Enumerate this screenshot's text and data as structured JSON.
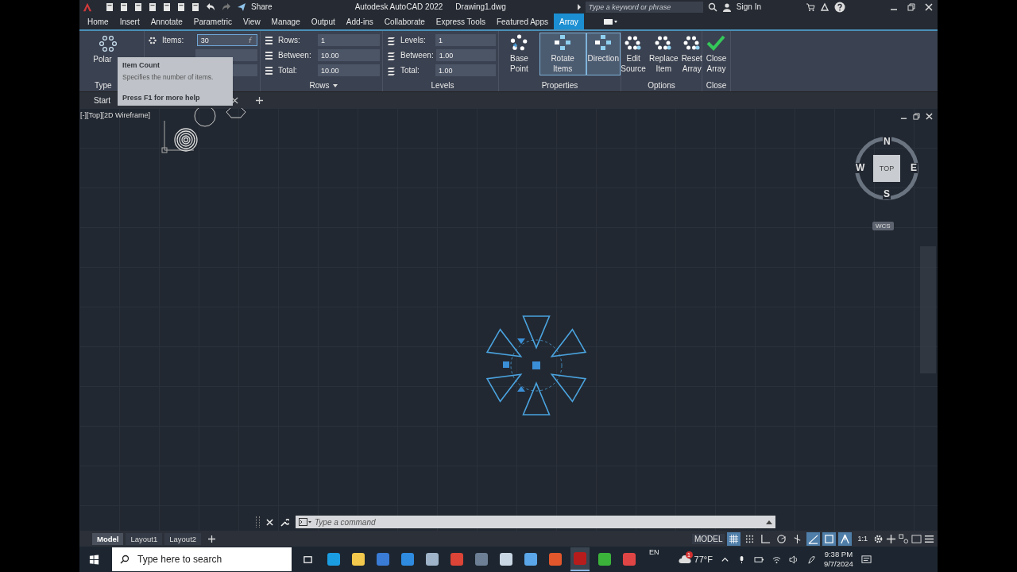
{
  "title_bar": {
    "share": "Share",
    "app_title": "Autodesk AutoCAD 2022",
    "file_name": "Drawing1.dwg",
    "search": {
      "placeholder": "Type a keyword or phrase"
    },
    "sign_in": "Sign In"
  },
  "ribbon_tabs": [
    {
      "label": "Home",
      "selected": false
    },
    {
      "label": "Insert",
      "selected": false
    },
    {
      "label": "Annotate",
      "selected": false
    },
    {
      "label": "Parametric",
      "selected": false
    },
    {
      "label": "View",
      "selected": false
    },
    {
      "label": "Manage",
      "selected": false
    },
    {
      "label": "Output",
      "selected": false
    },
    {
      "label": "Add-ins",
      "selected": false
    },
    {
      "label": "Collaborate",
      "selected": false
    },
    {
      "label": "Express Tools",
      "selected": false
    },
    {
      "label": "Featured Apps",
      "selected": false
    },
    {
      "label": "Array",
      "selected": true
    }
  ],
  "ribbon": {
    "type_panel": {
      "button": "Polar",
      "title": "Type"
    },
    "items_panel": {
      "label": "Items:",
      "value": "30"
    },
    "rows_panel": {
      "title": "Rows",
      "fields": [
        {
          "label": "Rows:",
          "value": "1"
        },
        {
          "label": "Between:",
          "value": "10.00"
        },
        {
          "label": "Total:",
          "value": "10.00"
        }
      ]
    },
    "levels_panel": {
      "title": "Levels",
      "fields": [
        {
          "label": "Levels:",
          "value": "1"
        },
        {
          "label": "Between:",
          "value": "1.00"
        },
        {
          "label": "Total:",
          "value": "1.00"
        }
      ]
    },
    "properties_panel": {
      "title": "Properties",
      "buttons": [
        {
          "label": "Base Point",
          "selected": false
        },
        {
          "label": "Rotate Items",
          "selected": true
        },
        {
          "label": "Direction",
          "selected": true
        }
      ]
    },
    "options_panel": {
      "title": "Options",
      "buttons": [
        {
          "line1": "Edit",
          "line2": "Source"
        },
        {
          "line1": "Replace",
          "line2": "Item"
        },
        {
          "line1": "Reset",
          "line2": "Array"
        }
      ]
    },
    "close_panel": {
      "title": "Close",
      "line1": "Close",
      "line2": "Array"
    }
  },
  "tooltip": {
    "title": "Item Count",
    "description": "Specifies the number of items.",
    "help": "Press F1 for more help"
  },
  "file_tabs": [
    {
      "label": "Start"
    }
  ],
  "viewport": {
    "label": "[-][Top][2D Wireframe]",
    "viewcube": {
      "north": "N",
      "west": "W",
      "east": "E",
      "south": "S",
      "face": "TOP",
      "ucs": "WCS"
    }
  },
  "command_line": {
    "placeholder": "Type a command"
  },
  "layout_tabs": [
    {
      "label": "Model",
      "selected": true
    },
    {
      "label": "Layout1",
      "selected": false
    },
    {
      "label": "Layout2",
      "selected": false
    }
  ],
  "status_bar": {
    "space": "MODEL",
    "scale": "1:1",
    "toggles": [
      {
        "kind": "grid",
        "on": true
      },
      {
        "kind": "snap",
        "on": false
      },
      {
        "kind": "ortho",
        "on": false
      },
      {
        "kind": "polar",
        "on": false
      },
      {
        "kind": "isodraft",
        "on": false
      },
      {
        "kind": "track",
        "on": true
      },
      {
        "kind": "osnap",
        "on": true
      },
      {
        "kind": "annovis",
        "on": true
      }
    ]
  },
  "taskbar": {
    "search": {
      "placeholder": "Type here to search"
    },
    "apps": [
      {
        "kind": "edge",
        "active": false
      },
      {
        "kind": "folder",
        "active": false
      },
      {
        "kind": "store",
        "active": false
      },
      {
        "kind": "mail",
        "active": false
      },
      {
        "kind": "network",
        "active": false
      },
      {
        "kind": "chrome",
        "active": false
      },
      {
        "kind": "calculator",
        "active": false
      },
      {
        "kind": "snip",
        "active": false
      },
      {
        "kind": "computer",
        "active": false
      },
      {
        "kind": "reader",
        "active": false
      },
      {
        "kind": "autocad",
        "active": true
      },
      {
        "kind": "camtasia",
        "active": false
      },
      {
        "kind": "recorder",
        "active": false
      }
    ],
    "language": "EN",
    "weather_badge": "1",
    "temperature": "77°F",
    "time": "9:38 PM",
    "date": "9/7/2024"
  }
}
